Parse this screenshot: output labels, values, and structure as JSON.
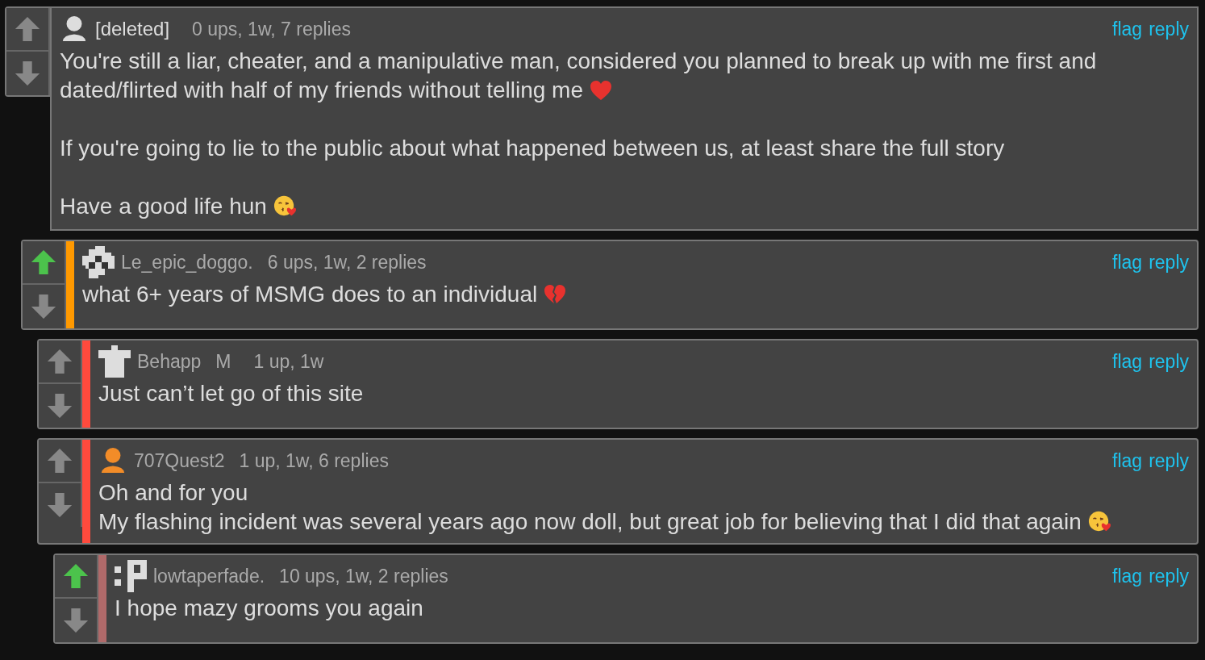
{
  "comments": [
    {
      "upvoted": false,
      "avatar": {
        "kind": "person-grey"
      },
      "username": "[deleted]",
      "meta": "0 ups, 1w, 7 replies",
      "actions": [
        "flag",
        "reply"
      ],
      "paragraphs": [
        {
          "lines": [
            {
              "text": "You're still a liar, cheater, and a manipulative man, considered you planned to break up with me first and dated/flirted with half of my friends without telling me",
              "emoji": {
                "kind": "heart"
              }
            }
          ]
        },
        {
          "lines": [
            {
              "text": "If you're going to lie to the public about what happened between us, at least share the full story"
            }
          ]
        },
        {
          "lines": [
            {
              "text": "Have a good life hun",
              "emoji": {
                "kind": "kiss"
              }
            }
          ]
        }
      ],
      "children": [
        {
          "upvoted": true,
          "color": "#ff9900",
          "avatar": {
            "kind": "checker"
          },
          "username": "Le_epic_doggo.",
          "meta": "6 ups, 1w, 2 replies",
          "actions": [
            "flag",
            "reply"
          ],
          "paragraphs": [
            {
              "lines": [
                {
                  "text": "what 6+ years of MSMG does to an individual",
                  "emoji": {
                    "kind": "broken-heart"
                  }
                }
              ]
            }
          ],
          "children": [
            {
              "upvoted": false,
              "color": "#ff4a3d",
              "avatar": {
                "kind": "shirt"
              },
              "username": "Behapp",
              "badge": "M",
              "meta": "1 up, 1w",
              "actions": [
                "flag",
                "reply"
              ],
              "paragraphs": [
                {
                  "lines": [
                    {
                      "text": "Just can’t let go of this site"
                    }
                  ]
                }
              ]
            },
            {
              "upvoted": false,
              "color": "#ff4a3d",
              "avatar": {
                "kind": "person-orange"
              },
              "username": "707Quest2",
              "meta": "1 up, 1w, 6 replies",
              "actions": [
                "flag",
                "reply"
              ],
              "paragraphs": [
                {
                  "lines": [
                    {
                      "text": "Oh and for you"
                    },
                    {
                      "text": "My flashing incident was several years ago now doll, but great job for believing that I did that again",
                      "emoji": {
                        "kind": "kiss"
                      }
                    }
                  ]
                }
              ],
              "children": [
                {
                  "upvoted": true,
                  "color": "#b06a6a",
                  "avatar": {
                    "kind": "glyph"
                  },
                  "username": "lowtaperfade.",
                  "meta": "10 ups, 1w, 2 replies",
                  "actions": [
                    "flag",
                    "reply"
                  ],
                  "paragraphs": [
                    {
                      "lines": [
                        {
                          "text": "I hope mazy grooms you again"
                        }
                      ]
                    }
                  ]
                }
              ]
            }
          ]
        }
      ]
    }
  ]
}
